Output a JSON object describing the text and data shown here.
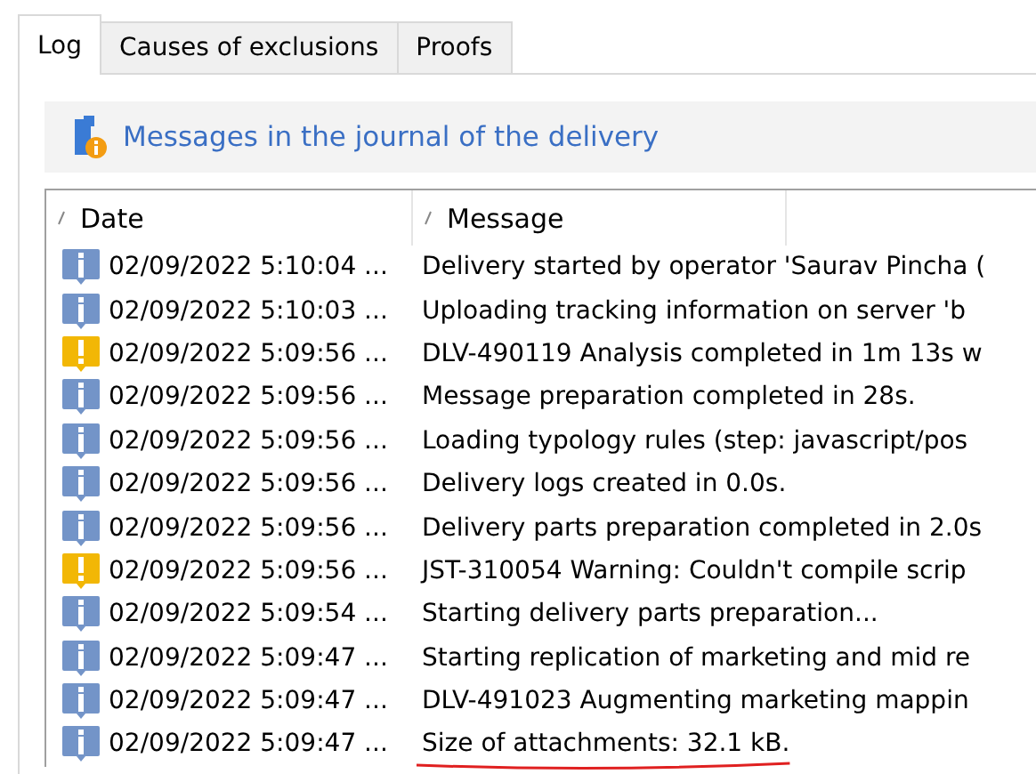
{
  "tabs": [
    {
      "label": "Log",
      "selected": true
    },
    {
      "label": "Causes of exclusions",
      "selected": false
    },
    {
      "label": "Proofs",
      "selected": false
    }
  ],
  "header": {
    "title": "Messages in the journal of the delivery"
  },
  "table": {
    "columns": [
      "Date",
      "Message"
    ],
    "rows": [
      {
        "kind": "info",
        "date": "02/09/2022 5:10:04 ...",
        "message": "Delivery started by operator 'Saurav Pincha (",
        "underlined": false
      },
      {
        "kind": "info",
        "date": "02/09/2022 5:10:03 ...",
        "message": "Uploading tracking information on server 'b",
        "underlined": false
      },
      {
        "kind": "warning",
        "date": "02/09/2022 5:09:56 ...",
        "message": "DLV-490119 Analysis completed in 1m  13s w",
        "underlined": false
      },
      {
        "kind": "info",
        "date": "02/09/2022 5:09:56 ...",
        "message": "Message preparation completed in 28s.",
        "underlined": false
      },
      {
        "kind": "info",
        "date": "02/09/2022 5:09:56 ...",
        "message": "Loading typology rules (step: javascript/pos",
        "underlined": false
      },
      {
        "kind": "info",
        "date": "02/09/2022 5:09:56 ...",
        "message": "Delivery logs created in 0.0s.",
        "underlined": false
      },
      {
        "kind": "info",
        "date": "02/09/2022 5:09:56 ...",
        "message": "Delivery parts preparation completed in 2.0s",
        "underlined": false
      },
      {
        "kind": "warning",
        "date": "02/09/2022 5:09:56 ...",
        "message": "JST-310054 Warning: Couldn't compile scrip",
        "underlined": false
      },
      {
        "kind": "info",
        "date": "02/09/2022 5:09:54 ...",
        "message": "Starting delivery parts preparation...",
        "underlined": false
      },
      {
        "kind": "info",
        "date": "02/09/2022 5:09:47 ...",
        "message": "Starting replication of marketing and mid re",
        "underlined": false
      },
      {
        "kind": "info",
        "date": "02/09/2022 5:09:47 ...",
        "message": "DLV-491023 Augmenting marketing mappin",
        "underlined": false
      },
      {
        "kind": "info",
        "date": "02/09/2022 5:09:47 ...",
        "message": "Size of attachments: 32.1 kB.",
        "underlined": true
      }
    ]
  }
}
